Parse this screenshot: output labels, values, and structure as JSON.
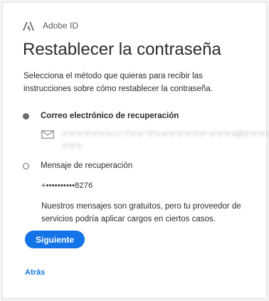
{
  "header": {
    "brand_label": "Adobe ID",
    "logo_icon": "adobe-logo-icon"
  },
  "main": {
    "title": "Restablecer la contraseña",
    "description": "Selecciona el método que quieras para recibir las instrucciones sobre cómo restablecer la contraseña.",
    "options": [
      {
        "label": "Correo electrónico de recuperación",
        "selected": true,
        "icon": "mail-icon",
        "masked_value_line1": "a*a*a*a*a*a*a-c7-f*a*a-*4*a-a*a*a*a*a*a*-a*a*a*a@a*a*a*a",
        "masked_value_line2": "a*a*a"
      },
      {
        "label": "Mensaje de recuperación",
        "selected": false,
        "phone": "+••••••••••8276"
      }
    ],
    "note": "Nuestros mensajes son gratuitos, pero tu proveedor de servicios podría aplicar cargos en ciertos casos.",
    "next_button": "Siguiente",
    "back_link": "Atrás"
  },
  "colors": {
    "accent": "#1473e6",
    "text": "#2c2c2c",
    "muted": "#5c5c5c",
    "radio": "#6b6b6b"
  }
}
